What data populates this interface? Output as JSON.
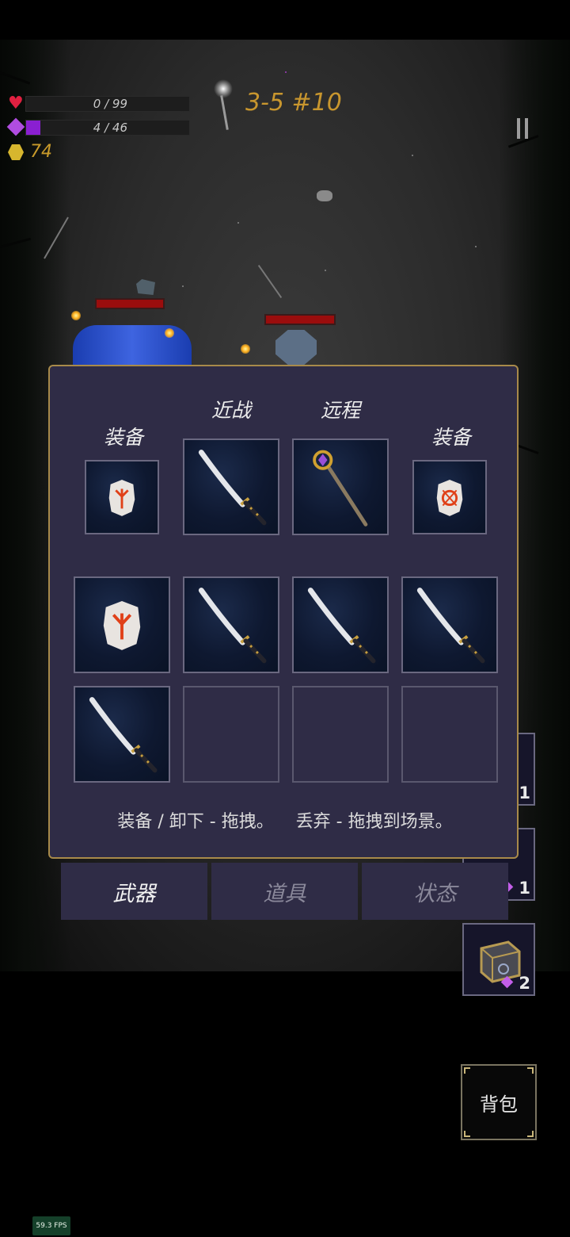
{
  "hud": {
    "hp_text": "0 / 99",
    "hp_current": 0,
    "hp_max": 99,
    "mana_text": "4 / 46",
    "mana_current": 4,
    "mana_max": 46,
    "gold": "74",
    "level": "3-5 #10"
  },
  "panel": {
    "label_equip_left": "装备",
    "label_melee": "近战",
    "label_ranged": "远程",
    "label_equip_right": "装备",
    "equip_slots": [
      {
        "item": "rune-stone-icon"
      },
      {
        "item": "katana-icon"
      },
      {
        "item": "staff-icon"
      },
      {
        "item": "rune-stone-red-icon"
      }
    ],
    "inventory": [
      {
        "item": "rune-stone-icon"
      },
      {
        "item": "katana-icon"
      },
      {
        "item": "katana-icon"
      },
      {
        "item": "katana-icon"
      },
      {
        "item": "katana-icon"
      },
      {
        "item": ""
      },
      {
        "item": ""
      },
      {
        "item": ""
      }
    ],
    "hint": "装备 / 卸下 - 拖拽。    丢弃 - 拖拽到场景。"
  },
  "tabs": [
    {
      "label": "武器",
      "active": true
    },
    {
      "label": "道具",
      "active": false
    },
    {
      "label": "状态",
      "active": false
    }
  ],
  "side_slots": [
    {
      "count": "1"
    },
    {
      "count": "1"
    },
    {
      "count": "2"
    }
  ],
  "bag_label": "背包",
  "fps": "59.3 FPS",
  "colors": {
    "panel_bg": "#2f2c46",
    "panel_border": "#a88a4a",
    "level_text": "#c8962e",
    "gold_text": "#c89a2a",
    "mana_fill": "#8a1fd1",
    "hp_icon": "#e02040"
  }
}
